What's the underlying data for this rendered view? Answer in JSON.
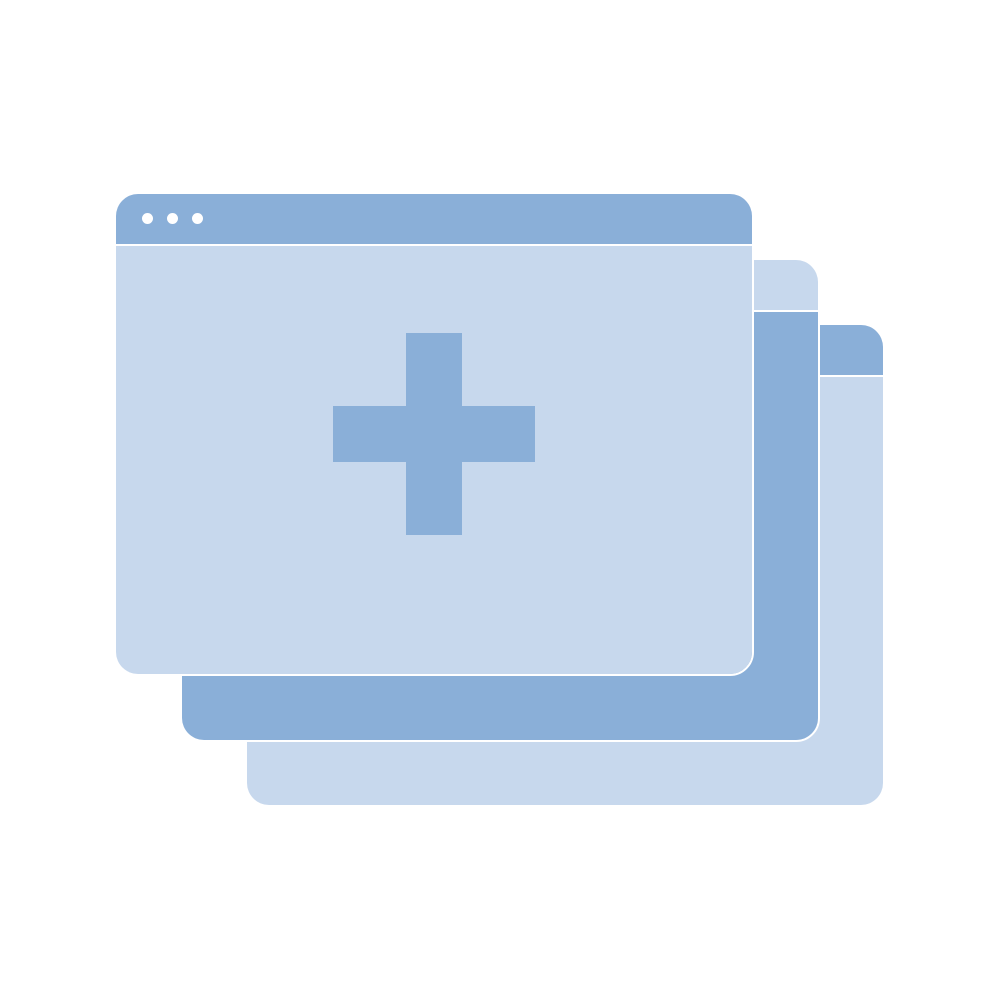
{
  "illustration": {
    "description_icon": "stacked-browser-windows-add-icon",
    "colors": {
      "accent": "#8aafd8",
      "light": "#c7d8ed",
      "background": "#ffffff"
    },
    "windows": [
      {
        "name": "back-window",
        "titlebar_color": "#8aafd8",
        "body_color": "#c7d8ed"
      },
      {
        "name": "middle-window",
        "titlebar_color": "#c7d8ed",
        "body_color": "#8aafd8"
      },
      {
        "name": "front-window",
        "titlebar_color": "#8aafd8",
        "body_color": "#c7d8ed"
      }
    ],
    "front_window": {
      "control_dots": 3,
      "center_icon": "plus-icon"
    }
  }
}
